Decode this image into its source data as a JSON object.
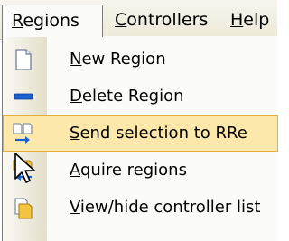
{
  "menubar": {
    "items": [
      {
        "label": "Regions",
        "mnemonic": "R",
        "rest": "egions",
        "open": true
      },
      {
        "label": "Controllers",
        "mnemonic": "C",
        "rest": "ontrollers"
      },
      {
        "label": "Help",
        "mnemonic": "H",
        "rest": "elp"
      }
    ]
  },
  "dropdown": {
    "items": [
      {
        "label": "New Region",
        "mnemonic": "N",
        "rest": "ew Region",
        "icon": "new-document-icon"
      },
      {
        "label": "Delete Region",
        "mnemonic": "D",
        "rest": "elete Region",
        "icon": "delete-dash-icon"
      },
      {
        "label": "Send selection to RRe",
        "mnemonic": "S",
        "rest": "end selection to RRe",
        "icon": "send-selection-icon",
        "highlighted": true
      },
      {
        "label": "Aquire regions",
        "mnemonic": "A",
        "rest": "quire regions",
        "icon": "acquire-regions-icon"
      },
      {
        "label": "View/hide controller list",
        "mnemonic": "V",
        "rest": "iew/hide controller list",
        "icon": "controller-list-icon"
      }
    ]
  },
  "colors": {
    "highlight_fill": "#fce8ab",
    "highlight_border": "#e4ad3c",
    "icon_blue": "#1a5fd1",
    "icon_yellow": "#f5c542"
  }
}
